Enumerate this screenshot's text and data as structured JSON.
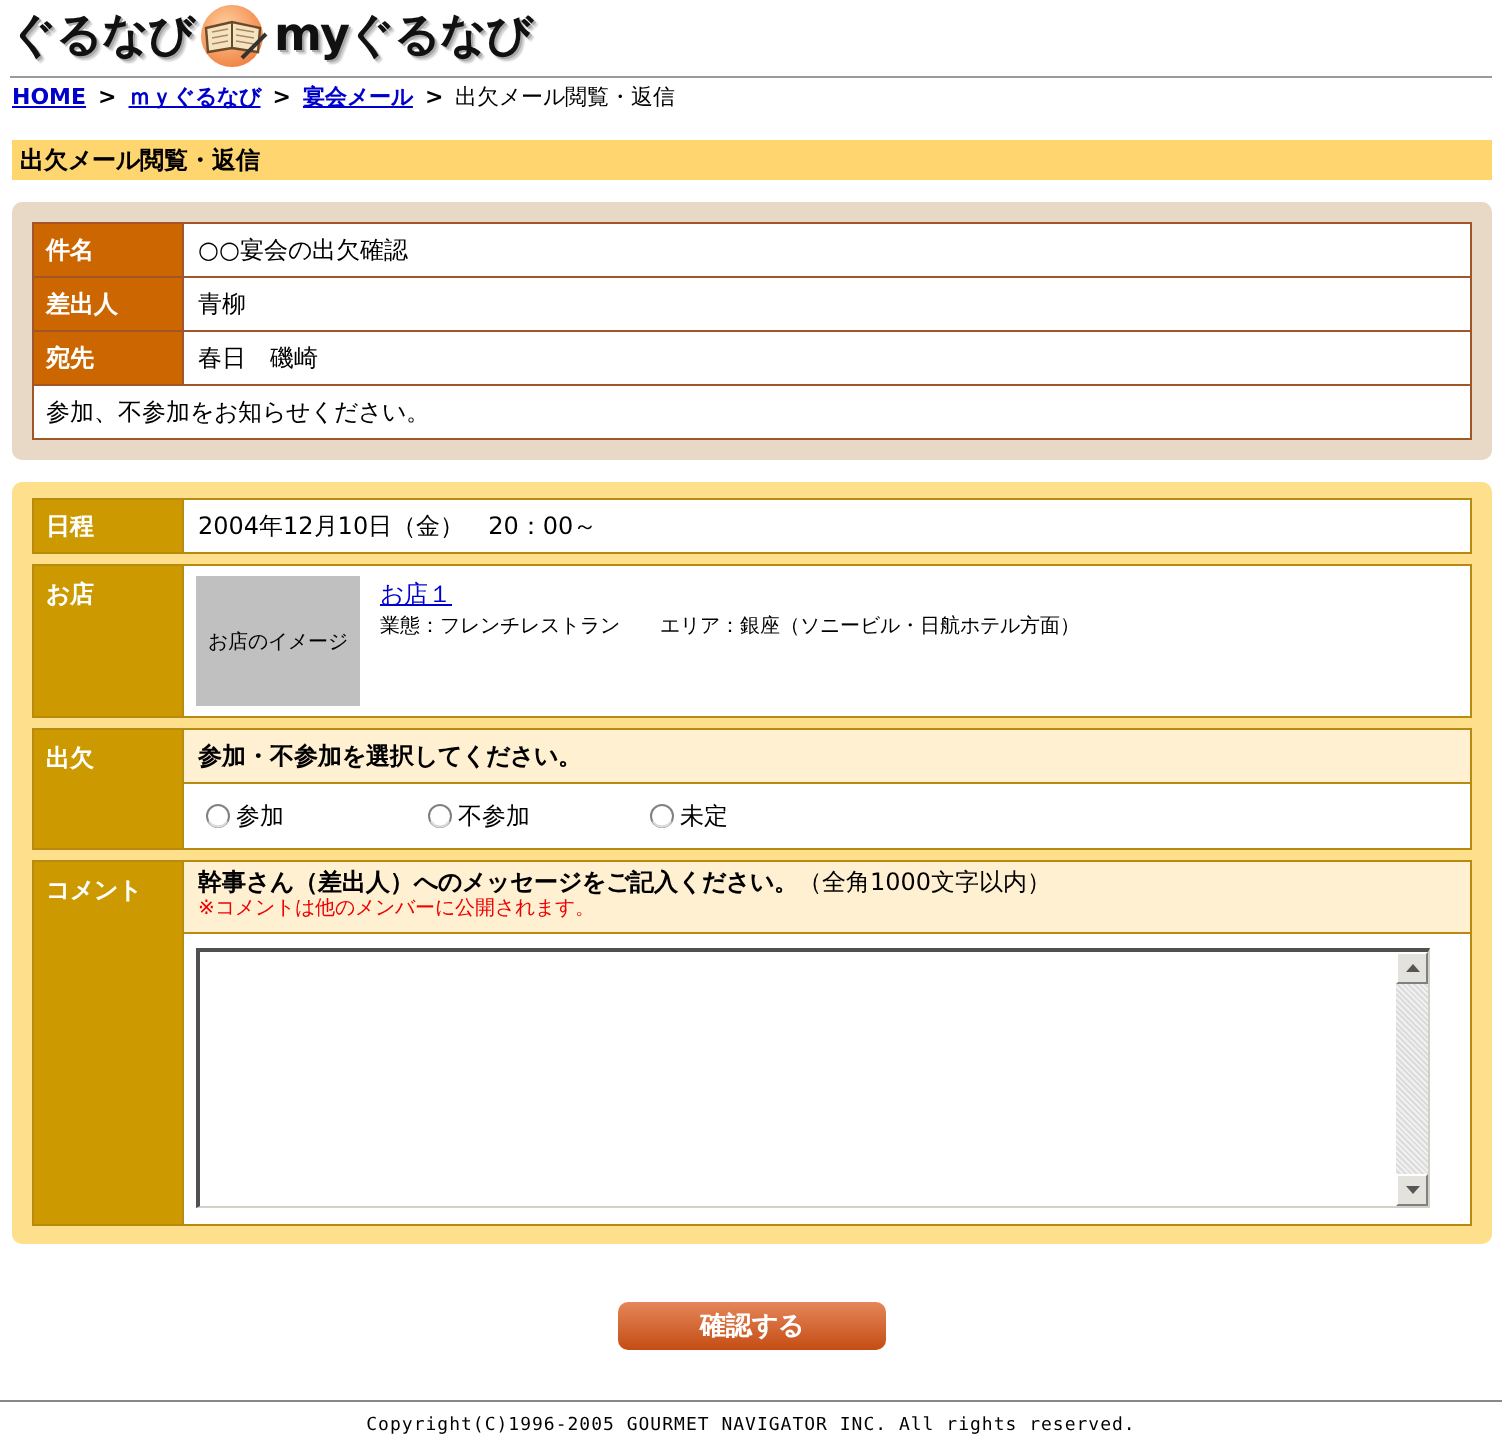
{
  "header": {
    "logo_text": "ぐるなび",
    "logo_sub": "myぐるなび"
  },
  "breadcrumb": {
    "separator": ">",
    "items": [
      {
        "label": "HOME",
        "link": true
      },
      {
        "label": "ｍｙぐるなび",
        "link": true
      },
      {
        "label": "宴会メール",
        "link": true
      },
      {
        "label": "出欠メール閲覧・返信",
        "link": false
      }
    ]
  },
  "page_title": "出欠メール閲覧・返信",
  "mail": {
    "fields": [
      {
        "label": "件名",
        "value": "○○宴会の出欠確認"
      },
      {
        "label": "差出人",
        "value": "青柳"
      },
      {
        "label": "宛先",
        "value": "春日　磯崎"
      }
    ],
    "body": "参加、不参加をお知らせください。"
  },
  "event": {
    "schedule": {
      "label": "日程",
      "value": "2004年12月10日（金）　20：00～"
    },
    "shop": {
      "label": "お店",
      "image_caption": "お店のイメージ",
      "name": "お店１",
      "details": "業態：フレンチレストラン　　エリア：銀座（ソニービル・日航ホテル方面）"
    },
    "attendance": {
      "label": "出欠",
      "prompt": "参加・不参加を選択してください。",
      "options": [
        {
          "label": "参加",
          "selected": false
        },
        {
          "label": "不参加",
          "selected": false
        },
        {
          "label": "未定",
          "selected": false
        }
      ]
    },
    "comment": {
      "label": "コメント",
      "prompt": "**幹事さん（差出人）へのメッセージをご記入ください。**（全角1000文字以内）",
      "notice": "※コメントは他のメンバーに公開されます。"
    }
  },
  "confirm_button": "確認する",
  "footer": "Copyright(C)1996-2005 GOURMET NAVIGATOR INC. All rights reserved."
}
